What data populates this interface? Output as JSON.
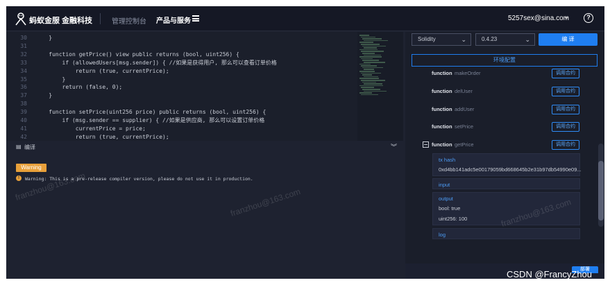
{
  "topnav": {
    "brand_primary": "蚂蚁金服",
    "brand_secondary": "金融科技",
    "nav_console": "管理控制台",
    "nav_products": "产品与服务",
    "account_email": "5257sex@sina.com",
    "help_glyph": "?"
  },
  "editor": {
    "lines": [
      {
        "n": "30",
        "code": "    }"
      },
      {
        "n": "31",
        "code": ""
      },
      {
        "n": "32",
        "code": "    function getPrice() view public returns (bool, uint256) {"
      },
      {
        "n": "33",
        "code": "        if (allowedUsers[msg.sender]) { //如果是获得用户, 那么可以查看订单价格"
      },
      {
        "n": "34",
        "code": "            return (true, currentPrice);"
      },
      {
        "n": "35",
        "code": "        }"
      },
      {
        "n": "36",
        "code": "        return (false, 0);"
      },
      {
        "n": "37",
        "code": "    }"
      },
      {
        "n": "38",
        "code": ""
      },
      {
        "n": "39",
        "code": "    function setPrice(uint256 price) public returns (bool, uint256) {"
      },
      {
        "n": "40",
        "code": "        if (msg.sender == supplier) { //如果是供应商, 那么可以设置订单价格"
      },
      {
        "n": "41",
        "code": "            currentPrice = price;"
      },
      {
        "n": "42",
        "code": "            return (true, currentPrice);"
      }
    ]
  },
  "output": {
    "title": "编译",
    "warning_badge": "Warning",
    "warning_text": "Warning: This is a pre-release compiler version, please do not use it in production."
  },
  "compiler": {
    "language": "Solidity",
    "version": "0.4.23",
    "compile_label": "编 译",
    "env_label": "环境配置"
  },
  "functions": {
    "keyword": "function",
    "call_label": "调用合约",
    "names": [
      "makeOrder",
      "delUser",
      "addUser",
      "setPrice",
      "getPrice"
    ]
  },
  "result": {
    "tx_label": "tx hash",
    "tx_value": "0xd4bb141adc5e00179059bd668645b2e31b97db54990e09...",
    "input_label": "input",
    "output_label": "output",
    "output_bool": "bool: true",
    "output_uint": "uint256: 100",
    "log_label": "log"
  },
  "bottom_button": "部署",
  "watermark_text": "franzhou@163.com",
  "csdn_credit": "CSDN @FrancyZhou"
}
